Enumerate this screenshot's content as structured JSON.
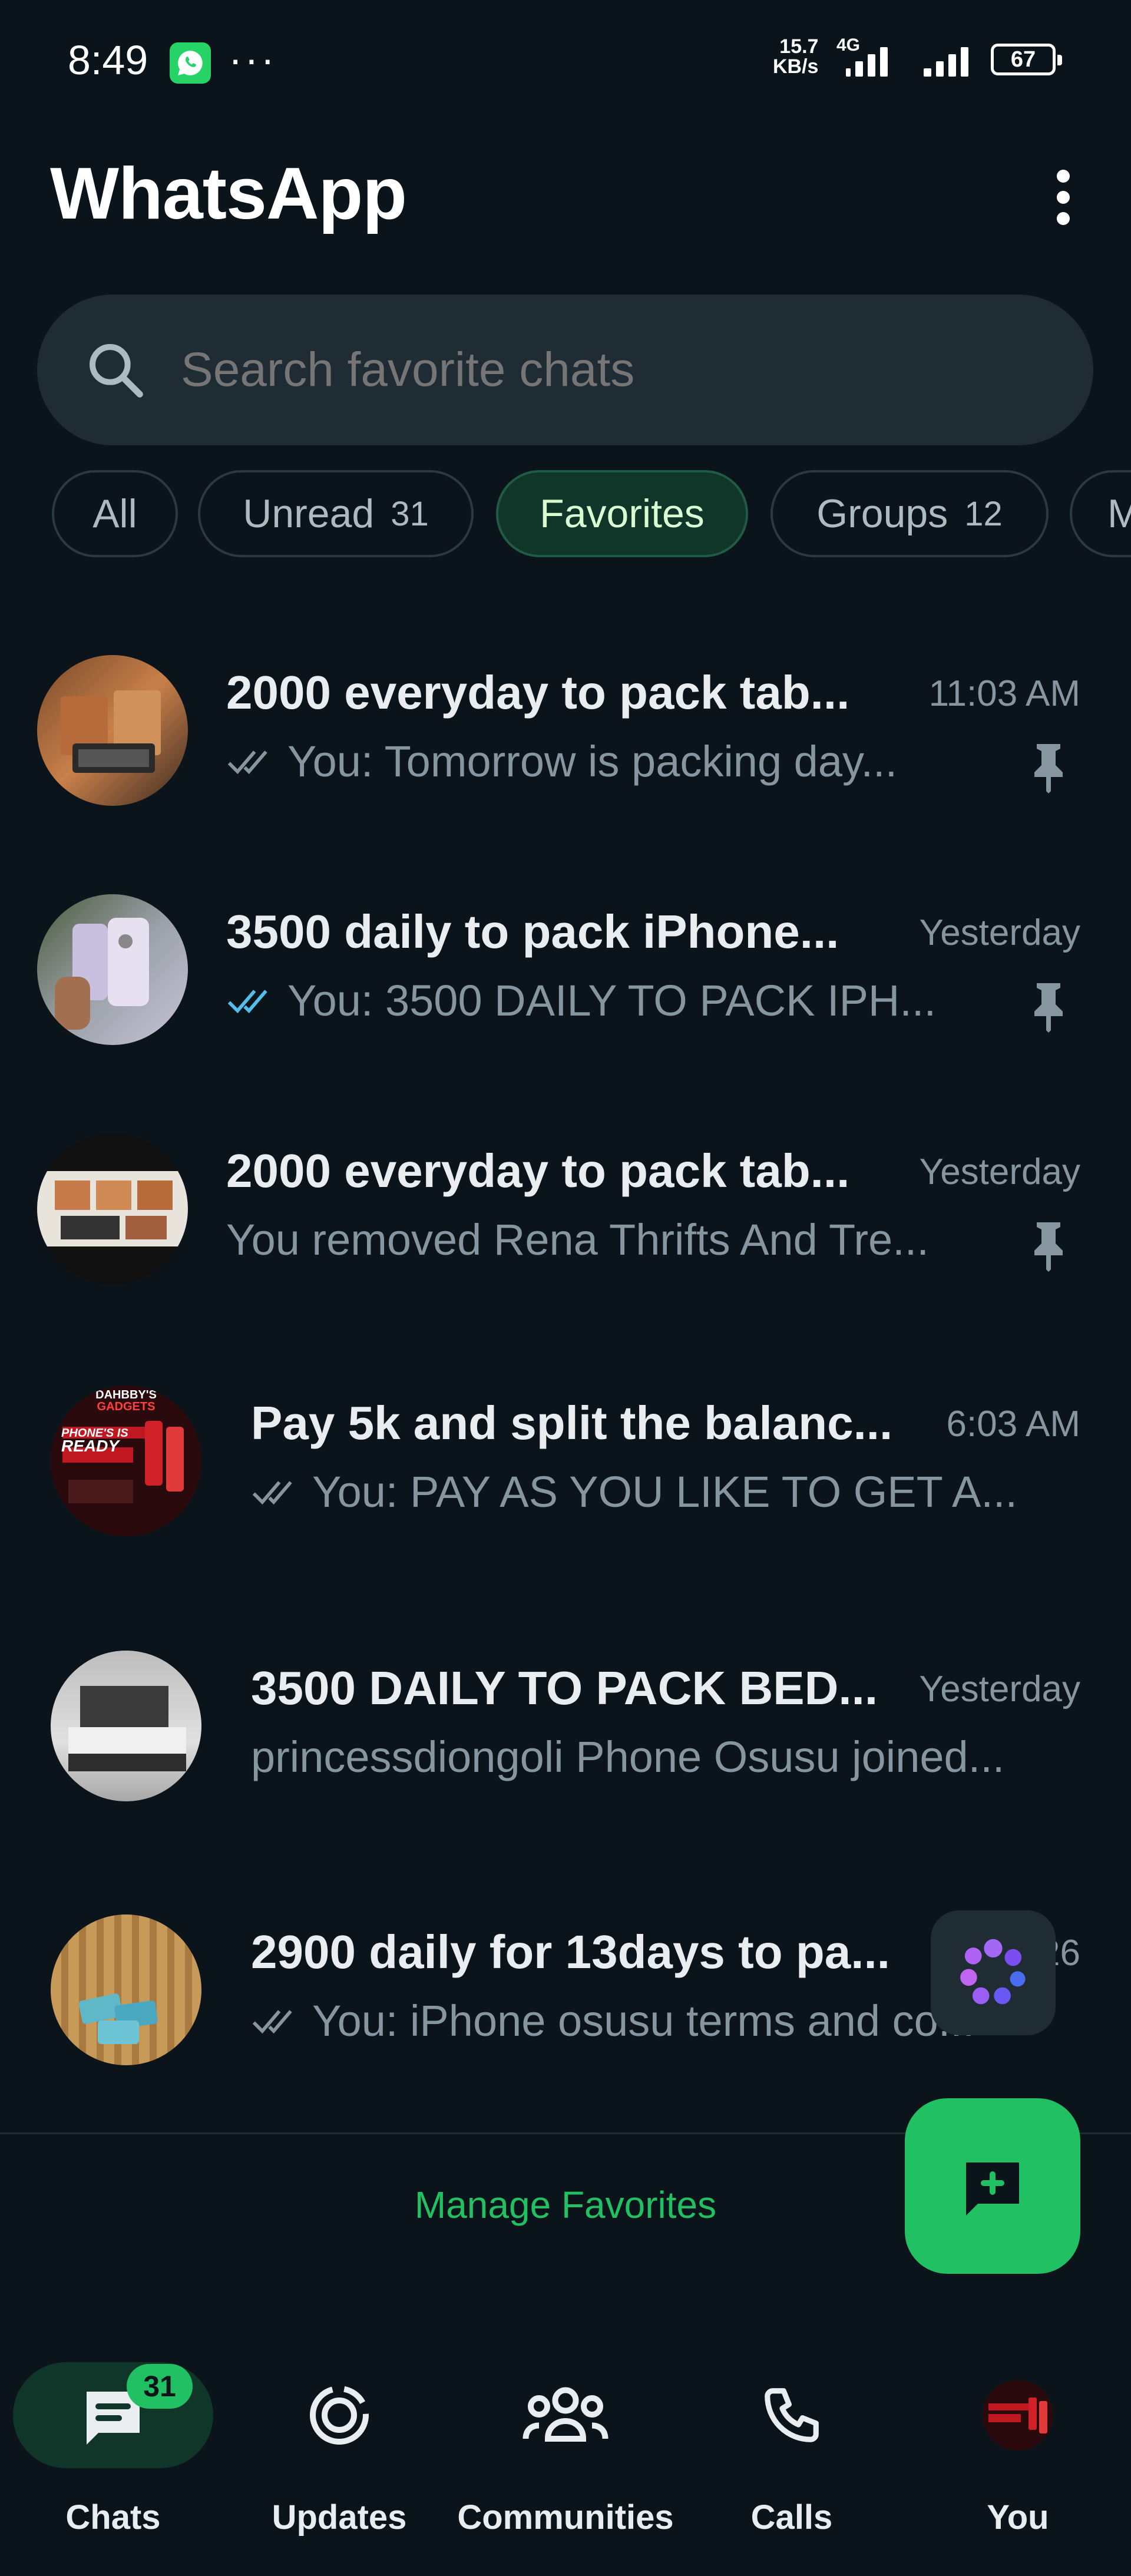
{
  "status_bar": {
    "time": "8:49",
    "net_speed_value": "15.7",
    "net_speed_unit": "KB/s",
    "network_type": "4G",
    "battery": "67"
  },
  "header": {
    "title": "WhatsApp"
  },
  "search": {
    "placeholder": "Search favorite chats"
  },
  "filters": [
    {
      "label": "All",
      "count": ""
    },
    {
      "label": "Unread",
      "count": "31"
    },
    {
      "label": "Favorites",
      "count": ""
    },
    {
      "label": "Groups",
      "count": "12"
    },
    {
      "label": "M",
      "count": ""
    }
  ],
  "chats": [
    {
      "name": "2000 everyday to pack tab...",
      "time": "11:03 AM",
      "preview": "You: Tomorrow is packing day...",
      "ticks": "read-grey",
      "pinned": true
    },
    {
      "name": "3500 daily to pack iPhone...",
      "time": "Yesterday",
      "preview": "You: 3500 DAILY TO PACK IPH...",
      "ticks": "read-blue",
      "pinned": true
    },
    {
      "name": "2000 everyday to pack tab...",
      "time": "Yesterday",
      "preview": "You removed Rena Thrifts And Tre...",
      "ticks": "none",
      "pinned": true
    },
    {
      "name": "Pay 5k and split the balanc...",
      "time": "6:03 AM",
      "preview": "You: PAY AS YOU LIKE TO GET A...",
      "ticks": "read-grey",
      "pinned": false
    },
    {
      "name": "3500 DAILY TO PACK BED...",
      "time": "Yesterday",
      "preview": "princessdiongoli Phone Osusu joined...",
      "ticks": "none",
      "pinned": false
    },
    {
      "name": "2900 daily for 13days to pa...",
      "time": "26",
      "preview": "You: iPhone osusu terms and co...",
      "ticks": "read-grey",
      "pinned": false
    }
  ],
  "avatar_texts": {
    "gadgets_line1": "DAHBBY'S",
    "gadgets_line2": "GADGETS",
    "gadgets_line3": "PHONE'S IS",
    "gadgets_line4": "READY"
  },
  "manage_favorites": "Manage Favorites",
  "bottom_nav": [
    {
      "label": "Chats",
      "icon": "chats-icon",
      "badge": "31",
      "active": true
    },
    {
      "label": "Updates",
      "icon": "updates-icon",
      "active": false
    },
    {
      "label": "Communities",
      "icon": "communities-icon",
      "active": false
    },
    {
      "label": "Calls",
      "icon": "phone-icon",
      "active": false
    },
    {
      "label": "You",
      "icon": "profile-avatar",
      "active": false
    }
  ],
  "colors": {
    "background": "#0b141a",
    "accent": "#21c063",
    "active_chip": "#103529",
    "read_tick_blue": "#53bdeb",
    "muted_text": "#8696a0"
  }
}
